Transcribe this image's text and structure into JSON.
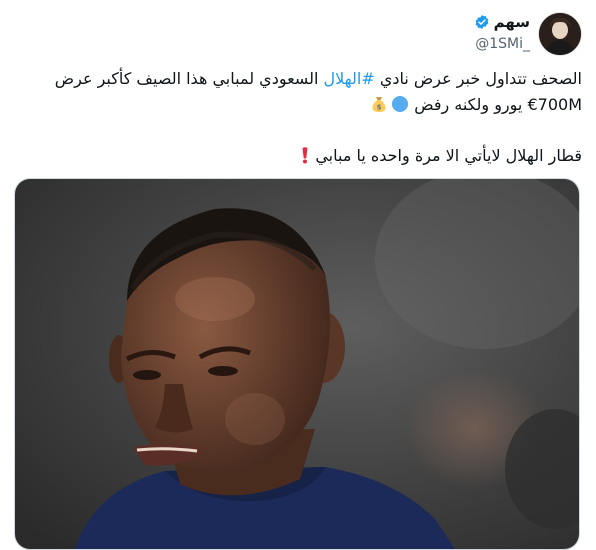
{
  "author": {
    "display_name": "سهم",
    "handle": "@1SMi_"
  },
  "tweet": {
    "line1_before": "الصحف تتداول خبر عرض نادي ",
    "hashtag": "#الهلال",
    "line1_after": " السعودي لمبابي هذا الصيف كأكبر عرض",
    "line2": "€700M يورو ولكنه رفض ",
    "para2": "قطار الهلال لايأتي الا مرة واحده يا مبابي "
  },
  "icons": {
    "verified": "verified-badge-icon",
    "blue_circle": "blue-circle-emoji",
    "money_bag": "money-bag-emoji",
    "exclamation": "red-exclamation-emoji"
  },
  "colors": {
    "accent": "#1d9bf0",
    "text": "#0f1419",
    "muted": "#536471",
    "jersey": "#1c2a5a"
  }
}
